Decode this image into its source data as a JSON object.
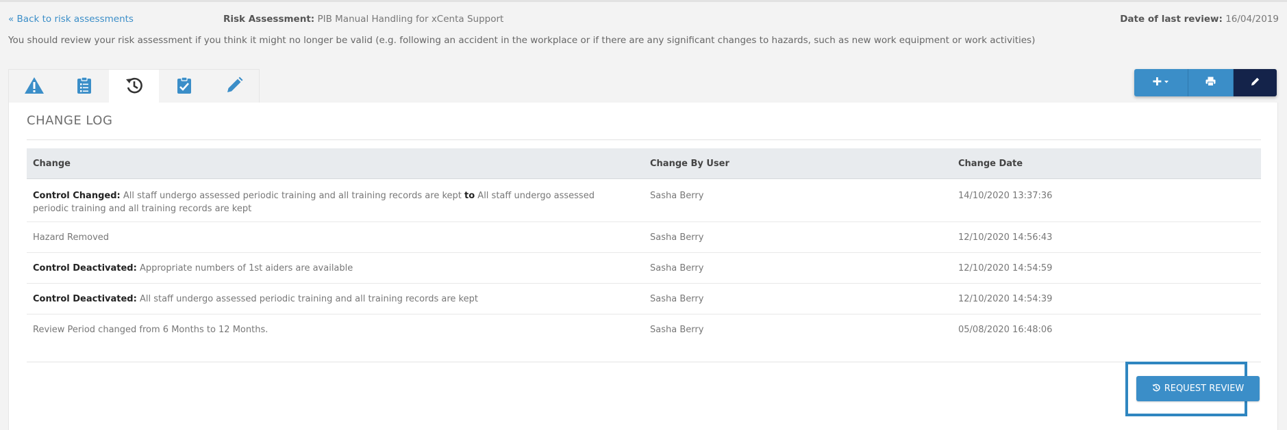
{
  "header": {
    "back_link": "« Back to risk assessments",
    "title_label": "Risk Assessment:",
    "title_value": "PIB Manual Handling for xCenta Support",
    "last_review_label": "Date of last review:",
    "last_review_value": "16/04/2019"
  },
  "notice": "You should review your risk assessment if you think it might no longer be valid (e.g. following an accident in the workplace or if there are any significant changes to hazards, such as new work equipment or work activities)",
  "tabs": [
    {
      "icon": "warning-icon",
      "active": false
    },
    {
      "icon": "clipboard-list-icon",
      "active": false
    },
    {
      "icon": "history-icon",
      "active": true
    },
    {
      "icon": "clipboard-check-icon",
      "active": false
    },
    {
      "icon": "pencil-icon",
      "active": false
    }
  ],
  "actions": {
    "add_icon": "plus-icon",
    "print_icon": "print-icon",
    "edit_icon": "pencil-icon"
  },
  "panel_title": "CHANGE LOG",
  "table": {
    "columns": [
      "Change",
      "Change By User",
      "Change Date"
    ],
    "rows": [
      {
        "label": "Control Changed:",
        "text": "All staff undergo assessed periodic training and all training records are kept",
        "connector": "to",
        "text2": "All staff undergo assessed periodic training and all training records are kept",
        "user": "Sasha Berry",
        "date": "14/10/2020 13:37:36"
      },
      {
        "label": "",
        "text": "Hazard Removed",
        "user": "Sasha Berry",
        "date": "12/10/2020 14:56:43"
      },
      {
        "label": "Control Deactivated:",
        "text": "Appropriate numbers of 1st aiders are available",
        "user": "Sasha Berry",
        "date": "12/10/2020 14:54:59"
      },
      {
        "label": "Control Deactivated:",
        "text": "All staff undergo assessed periodic training and all training records are kept",
        "user": "Sasha Berry",
        "date": "12/10/2020 14:54:39"
      },
      {
        "label": "",
        "text": "Review Period changed from 6 Months to 12 Months.",
        "user": "Sasha Berry",
        "date": "05/08/2020 16:48:06"
      }
    ]
  },
  "request_review": {
    "label": "REQUEST REVIEW",
    "icon": "history-icon"
  },
  "colors": {
    "primary": "#3b8ec8",
    "dark": "#14234a",
    "page_bg": "#f3f3f3",
    "highlight_frame": "#2f86c0"
  }
}
